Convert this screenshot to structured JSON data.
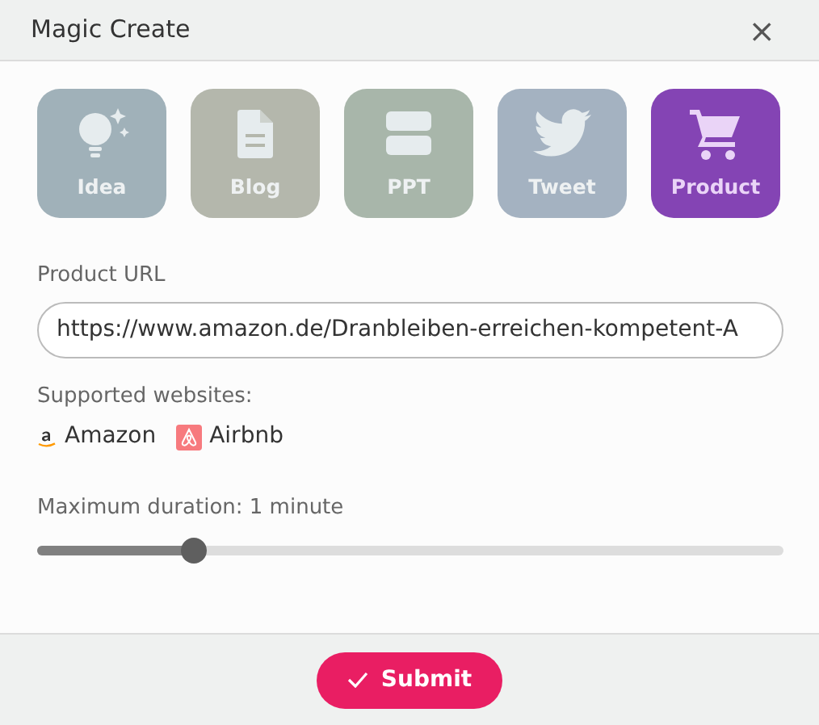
{
  "window": {
    "title": "Magic Create",
    "close": "×"
  },
  "tiles": [
    {
      "label": "Idea",
      "kind": "idea",
      "color": "#a0b1b9",
      "selected": false
    },
    {
      "label": "Blog",
      "kind": "blog",
      "color": "#b4b7ac",
      "selected": false
    },
    {
      "label": "PPT",
      "kind": "ppt",
      "color": "#a8b6aa",
      "selected": false
    },
    {
      "label": "Tweet",
      "kind": "tweet",
      "color": "#a4b2c1",
      "selected": false
    },
    {
      "label": "Product",
      "kind": "product",
      "color": "#8444b4",
      "selected": true
    }
  ],
  "url_field": {
    "label": "Product URL",
    "value": "https://www.amazon.de/Dranbleiben-erreichen-kompetent-A"
  },
  "supported": {
    "label": "Supported websites:",
    "sites": [
      {
        "name": "Amazon",
        "kind": "amazon"
      },
      {
        "name": "Airbnb",
        "kind": "airbnb"
      }
    ]
  },
  "duration": {
    "label": "Maximum duration: 1 minute",
    "level": 0.21
  },
  "submit": {
    "label": "Submit"
  }
}
